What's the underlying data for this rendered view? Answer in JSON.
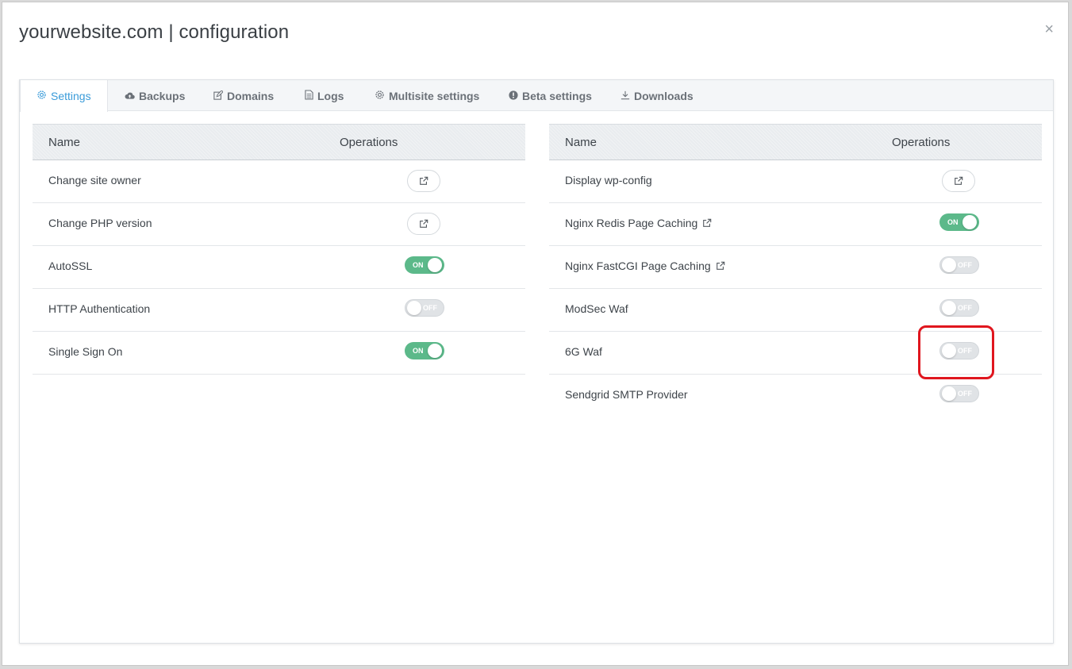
{
  "modal": {
    "title": "yourwebsite.com | configuration",
    "close": "×"
  },
  "tabs": [
    {
      "label": "Settings",
      "icon": "gear-icon",
      "active": true
    },
    {
      "label": "Backups",
      "icon": "cloud-upload-icon",
      "active": false
    },
    {
      "label": "Domains",
      "icon": "edit-icon",
      "active": false
    },
    {
      "label": "Logs",
      "icon": "document-icon",
      "active": false
    },
    {
      "label": "Multisite settings",
      "icon": "gear-icon",
      "active": false
    },
    {
      "label": "Beta settings",
      "icon": "exclamation-circle-icon",
      "active": false
    },
    {
      "label": "Downloads",
      "icon": "download-icon",
      "active": false
    }
  ],
  "left_table": {
    "headers": {
      "name": "Name",
      "operations": "Operations"
    },
    "rows": [
      {
        "label": "Change site owner",
        "op": "link"
      },
      {
        "label": "Change PHP version",
        "op": "link"
      },
      {
        "label": "AutoSSL",
        "op": "toggle",
        "state": "ON"
      },
      {
        "label": "HTTP Authentication",
        "op": "toggle",
        "state": "OFF"
      },
      {
        "label": "Single Sign On",
        "op": "toggle",
        "state": "ON"
      }
    ]
  },
  "right_table": {
    "headers": {
      "name": "Name",
      "operations": "Operations"
    },
    "rows": [
      {
        "label": "Display wp-config",
        "op": "link"
      },
      {
        "label": "Nginx Redis Page Caching",
        "op": "toggle",
        "state": "ON",
        "external": true
      },
      {
        "label": "Nginx FastCGI Page Caching",
        "op": "toggle",
        "state": "OFF",
        "external": true
      },
      {
        "label": "ModSec Waf",
        "op": "toggle",
        "state": "OFF"
      },
      {
        "label": "6G Waf",
        "op": "toggle",
        "state": "OFF",
        "highlighted": true
      },
      {
        "label": "Sendgrid SMTP Provider",
        "op": "toggle",
        "state": "OFF"
      }
    ]
  },
  "colors": {
    "accent": "#3a9bd9",
    "toggle_on": "#5cb98a",
    "toggle_off": "#e0e3e6",
    "highlight": "#e0161e"
  }
}
